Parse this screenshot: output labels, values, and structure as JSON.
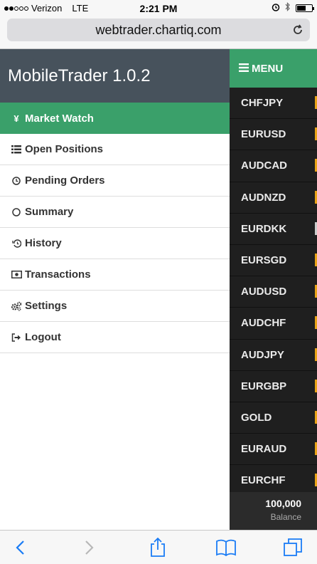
{
  "status_bar": {
    "carrier": "Verizon",
    "network": "LTE",
    "time": "2:21 PM"
  },
  "browser": {
    "url": "webtrader.chartiq.com"
  },
  "drawer": {
    "title": "MobileTrader 1.0.2",
    "items": [
      {
        "label": "Market Watch",
        "icon": "yen-icon",
        "active": true
      },
      {
        "label": "Open Positions",
        "icon": "list-icon"
      },
      {
        "label": "Pending Orders",
        "icon": "clock-icon"
      },
      {
        "label": "Summary",
        "icon": "circle-icon"
      },
      {
        "label": "History",
        "icon": "history-icon"
      },
      {
        "label": "Transactions",
        "icon": "money-icon"
      },
      {
        "label": "Settings",
        "icon": "gears-icon"
      },
      {
        "label": "Logout",
        "icon": "sign-out-icon"
      }
    ]
  },
  "right_panel": {
    "menu_label": "MENU",
    "markets": [
      "CHFJPY",
      "EURUSD",
      "AUDCAD",
      "AUDNZD",
      "EURDKK",
      "EURSGD",
      "AUDUSD",
      "AUDCHF",
      "AUDJPY",
      "EURGBP",
      "GOLD",
      "EURAUD",
      "EURCHF"
    ],
    "balance_amount": "100,000",
    "balance_label": "Balance"
  },
  "colors": {
    "accent_green": "#3aa06a",
    "header_slate": "#47525c",
    "panel_dark": "#1f1f1f",
    "price_orange": "#e8a317",
    "ios_blue": "#1a7cf5"
  }
}
